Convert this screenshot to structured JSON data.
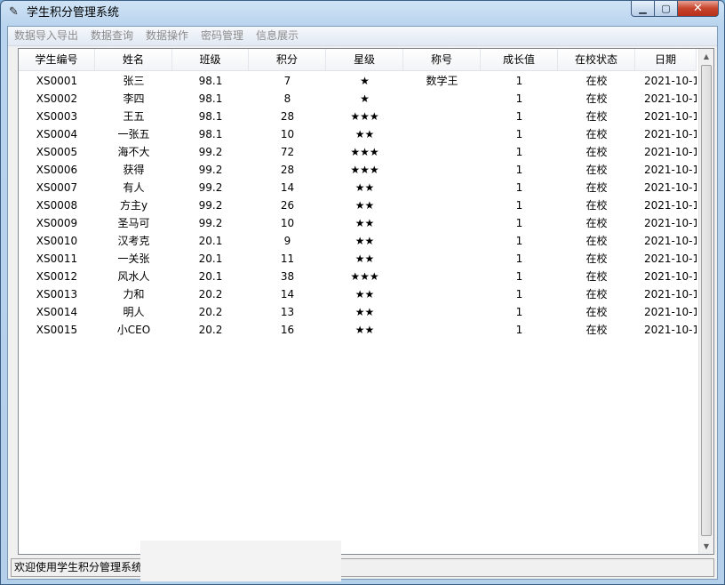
{
  "window": {
    "title": "学生积分管理系统",
    "icon": "feather-icon",
    "min_glyph": "▁",
    "max_glyph": "▢",
    "close_glyph": "✕"
  },
  "menu": [
    "数据导入导出",
    "数据查询",
    "数据操作",
    "密码管理",
    "信息展示"
  ],
  "table": {
    "columns": [
      "学生编号",
      "姓名",
      "班级",
      "积分",
      "星级",
      "称号",
      "成长值",
      "在校状态",
      "日期"
    ],
    "rows": [
      [
        "XS0001",
        "张三",
        "98.1",
        "7",
        "★",
        "数学王",
        "1",
        "在校",
        "2021-10-1"
      ],
      [
        "XS0002",
        "李四",
        "98.1",
        "8",
        "★",
        "",
        "1",
        "在校",
        "2021-10-1"
      ],
      [
        "XS0003",
        "王五",
        "98.1",
        "28",
        "★★★",
        "",
        "1",
        "在校",
        "2021-10-1"
      ],
      [
        "XS0004",
        "一张五",
        "98.1",
        "10",
        "★★",
        "",
        "1",
        "在校",
        "2021-10-1"
      ],
      [
        "XS0005",
        "海不大",
        "99.2",
        "72",
        "★★★",
        "",
        "1",
        "在校",
        "2021-10-1"
      ],
      [
        "XS0006",
        "获得",
        "99.2",
        "28",
        "★★★",
        "",
        "1",
        "在校",
        "2021-10-1"
      ],
      [
        "XS0007",
        "有人",
        "99.2",
        "14",
        "★★",
        "",
        "1",
        "在校",
        "2021-10-1"
      ],
      [
        "XS0008",
        "方主y",
        "99.2",
        "26",
        "★★",
        "",
        "1",
        "在校",
        "2021-10-1"
      ],
      [
        "XS0009",
        "圣马可",
        "99.2",
        "10",
        "★★",
        "",
        "1",
        "在校",
        "2021-10-1"
      ],
      [
        "XS0010",
        "汉考克",
        "20.1",
        "9",
        "★★",
        "",
        "1",
        "在校",
        "2021-10-1"
      ],
      [
        "XS0011",
        "一关张",
        "20.1",
        "11",
        "★★",
        "",
        "1",
        "在校",
        "2021-10-1"
      ],
      [
        "XS0012",
        "风水人",
        "20.1",
        "38",
        "★★★",
        "",
        "1",
        "在校",
        "2021-10-1"
      ],
      [
        "XS0013",
        "力和",
        "20.2",
        "14",
        "★★",
        "",
        "1",
        "在校",
        "2021-10-1"
      ],
      [
        "XS0014",
        "明人",
        "20.2",
        "13",
        "★★",
        "",
        "1",
        "在校",
        "2021-10-1"
      ],
      [
        "XS0015",
        "小CEO",
        "20.2",
        "16",
        "★★",
        "",
        "1",
        "在校",
        "2021-10-1"
      ]
    ]
  },
  "scrollbar": {
    "up_glyph": "▲",
    "down_glyph": "▼"
  },
  "status": {
    "text": "欢迎使用学生积分管理系统"
  }
}
